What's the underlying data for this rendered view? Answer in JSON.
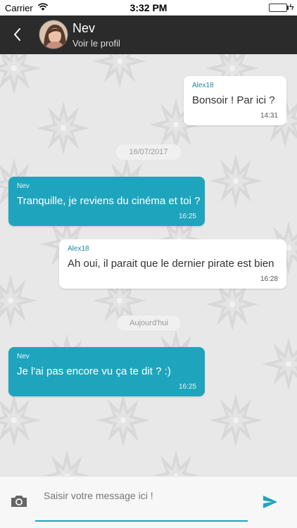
{
  "status_bar": {
    "carrier": "Carrier",
    "time": "3:32 PM",
    "icons": [
      "wifi-icon",
      "battery-icon",
      "charging-icon"
    ]
  },
  "header": {
    "contact_name": "Nev",
    "subtitle": "Voir le profil",
    "back_icon": "chevron-left-icon",
    "background": "#2b2b2b"
  },
  "messages": [
    {
      "direction": "out",
      "sender": "Alex18",
      "text": "Bonsoir ! Par ici ?",
      "time": "14:31"
    },
    {
      "date_separator": "16/07/2017"
    },
    {
      "direction": "in",
      "sender": "Nev",
      "text": "Tranquille, je reviens du cinéma et toi ?",
      "time": "16:25"
    },
    {
      "direction": "out",
      "sender": "Alex18",
      "text": "Ah oui, il parait que le dernier pirate est bien",
      "time": "16:28"
    },
    {
      "date_separator": "Aujourd'hui"
    },
    {
      "direction": "in",
      "sender": "Nev",
      "text": "Je l'ai pas encore vu ça te dit ? :)",
      "time": "16:25"
    }
  ],
  "composer": {
    "placeholder": "Saisir votre message ici !",
    "camera_icon": "camera-icon",
    "send_icon": "send-icon"
  },
  "colors": {
    "accent": "#1ea5bd",
    "outgoing_bubble": "#ffffff",
    "incoming_bubble": "#1ea5bd",
    "chat_background": "#e8e8e8"
  }
}
